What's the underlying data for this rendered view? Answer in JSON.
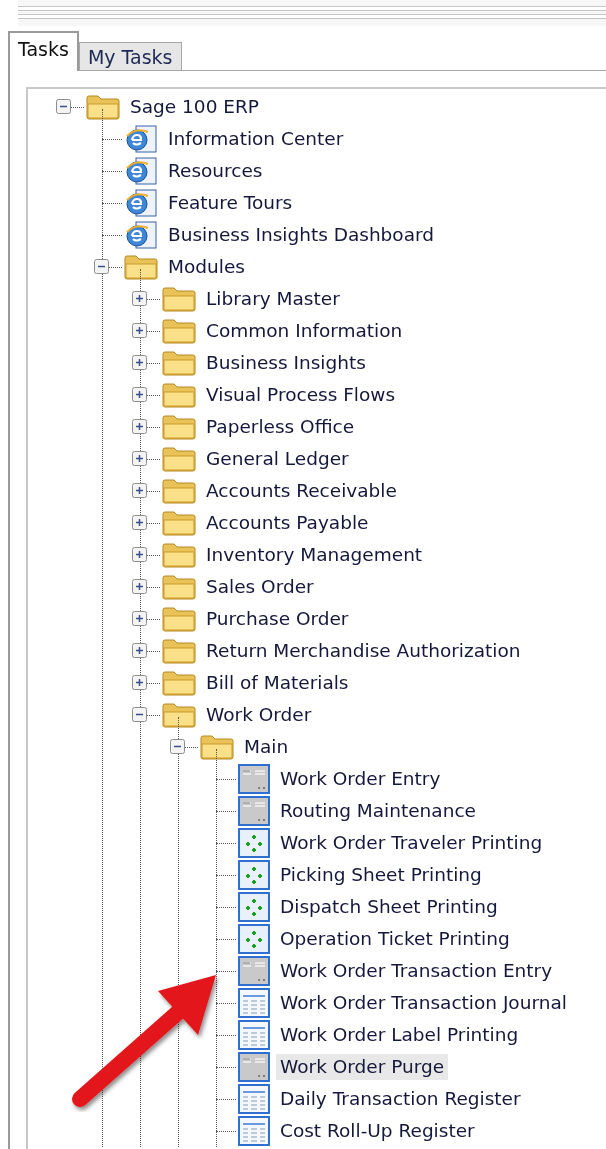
{
  "tabs": [
    {
      "label": "Tasks",
      "selected": true
    },
    {
      "label": "My Tasks",
      "selected": false
    }
  ],
  "tree": [
    {
      "kind": "folder",
      "label": "Sage 100 ERP",
      "expanded": true,
      "selected": false,
      "children": [
        {
          "kind": "web",
          "label": "Information Center",
          "selected": false
        },
        {
          "kind": "web",
          "label": "Resources",
          "selected": false
        },
        {
          "kind": "web",
          "label": "Feature Tours",
          "selected": false
        },
        {
          "kind": "web",
          "label": "Business Insights Dashboard",
          "selected": false
        },
        {
          "kind": "folder",
          "label": "Modules",
          "expanded": true,
          "selected": false,
          "children": [
            {
              "kind": "folder",
              "label": "Library Master",
              "expanded": false,
              "selected": false
            },
            {
              "kind": "folder",
              "label": "Common Information",
              "expanded": false,
              "selected": false
            },
            {
              "kind": "folder",
              "label": "Business Insights",
              "expanded": false,
              "selected": false
            },
            {
              "kind": "folder",
              "label": "Visual Process Flows",
              "expanded": false,
              "selected": false
            },
            {
              "kind": "folder",
              "label": "Paperless Office",
              "expanded": false,
              "selected": false
            },
            {
              "kind": "folder",
              "label": "General Ledger",
              "expanded": false,
              "selected": false
            },
            {
              "kind": "folder",
              "label": "Accounts Receivable",
              "expanded": false,
              "selected": false
            },
            {
              "kind": "folder",
              "label": "Accounts Payable",
              "expanded": false,
              "selected": false
            },
            {
              "kind": "folder",
              "label": "Inventory Management",
              "expanded": false,
              "selected": false
            },
            {
              "kind": "folder",
              "label": "Sales Order",
              "expanded": false,
              "selected": false
            },
            {
              "kind": "folder",
              "label": "Purchase Order",
              "expanded": false,
              "selected": false
            },
            {
              "kind": "folder",
              "label": "Return Merchandise Authorization",
              "expanded": false,
              "selected": false
            },
            {
              "kind": "folder",
              "label": "Bill of Materials",
              "expanded": false,
              "selected": false
            },
            {
              "kind": "folder",
              "label": "Work Order",
              "expanded": true,
              "selected": false,
              "children": [
                {
                  "kind": "folder",
                  "label": "Main",
                  "expanded": true,
                  "selected": false,
                  "children": [
                    {
                      "kind": "form",
                      "label": "Work Order Entry",
                      "selected": false
                    },
                    {
                      "kind": "form",
                      "label": "Routing Maintenance",
                      "selected": false
                    },
                    {
                      "kind": "process",
                      "label": "Work Order Traveler Printing",
                      "selected": false
                    },
                    {
                      "kind": "process",
                      "label": "Picking Sheet Printing",
                      "selected": false
                    },
                    {
                      "kind": "process",
                      "label": "Dispatch Sheet Printing",
                      "selected": false
                    },
                    {
                      "kind": "process",
                      "label": "Operation Ticket Printing",
                      "selected": false
                    },
                    {
                      "kind": "form",
                      "label": "Work Order Transaction Entry",
                      "selected": false
                    },
                    {
                      "kind": "report",
                      "label": "Work Order Transaction Journal",
                      "selected": false
                    },
                    {
                      "kind": "report",
                      "label": "Work Order Label Printing",
                      "selected": false
                    },
                    {
                      "kind": "form",
                      "label": "Work Order Purge",
                      "selected": true
                    },
                    {
                      "kind": "report",
                      "label": "Daily Transaction Register",
                      "selected": false
                    },
                    {
                      "kind": "report",
                      "label": "Cost Roll-Up Register",
                      "selected": false
                    }
                  ]
                }
              ]
            }
          ]
        }
      ]
    }
  ]
}
